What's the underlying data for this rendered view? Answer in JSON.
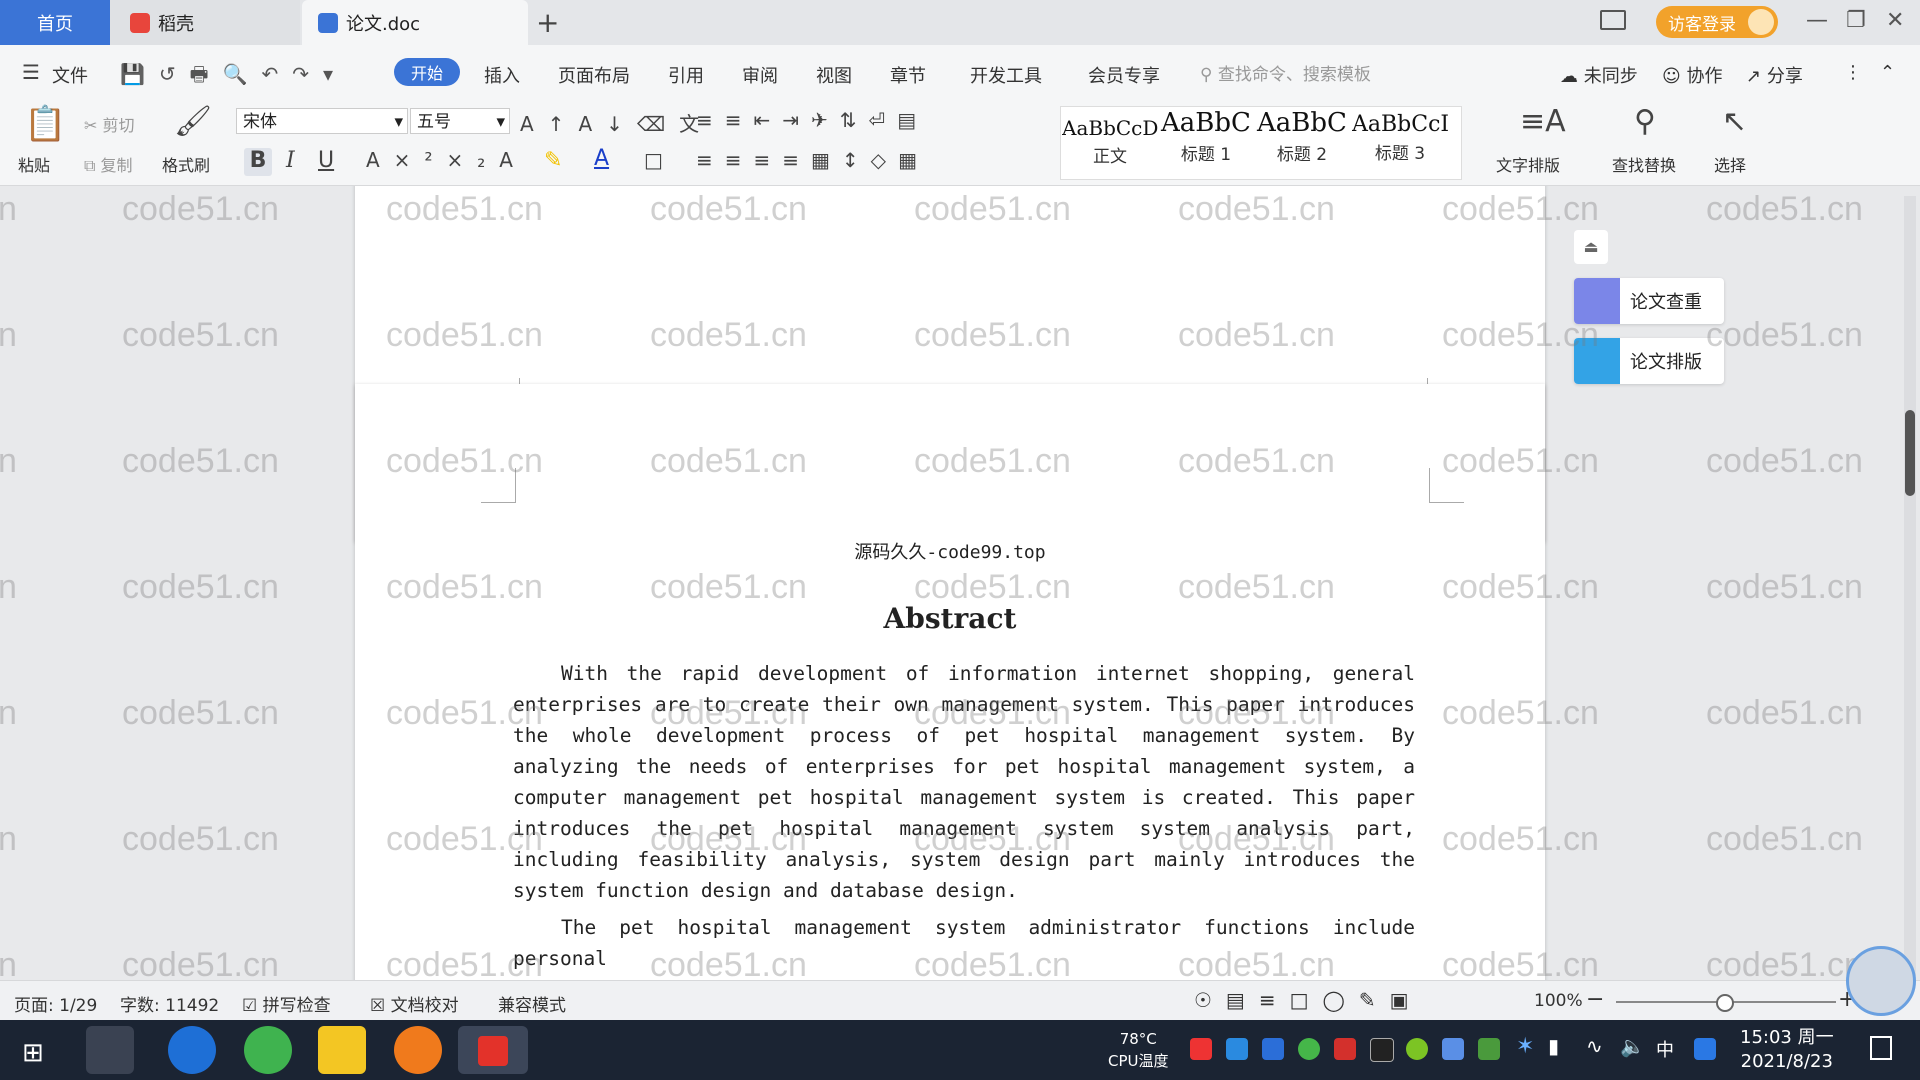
{
  "tabs": [
    {
      "label": "首页"
    },
    {
      "label": "稻壳"
    },
    {
      "label": "论文.doc"
    }
  ],
  "login_label": "访客登录",
  "menu": {
    "file": "文件",
    "items": [
      "开始",
      "插入",
      "页面布局",
      "引用",
      "审阅",
      "视图",
      "章节",
      "开发工具",
      "会员专享"
    ],
    "search_placeholder": "查找命令、搜索模板",
    "sync": "未同步",
    "collab": "协作",
    "share": "分享"
  },
  "toolbar": {
    "paste": "粘贴",
    "cut": "剪切",
    "copy": "复制",
    "format_painter": "格式刷",
    "font": "宋体",
    "size": "五号",
    "styles": [
      {
        "sample": "AaBbCcDd",
        "name": "正文"
      },
      {
        "sample": "AaBbC",
        "name": "标题 1"
      },
      {
        "sample": "AaBbC",
        "name": "标题 2"
      },
      {
        "sample": "AaBbCcI",
        "name": "标题 3"
      }
    ],
    "text_layout": "文字排版",
    "find_replace": "查找替换",
    "select": "选择"
  },
  "side_panel": {
    "check": "论文查重",
    "layout": "论文排版"
  },
  "document": {
    "header": "源码久久-code99.top",
    "title": "Abstract",
    "para1": "With the rapid development of information internet shopping, general enterprises are to create their own management system. This paper introduces the whole development process of pet hospital management system. By analyzing the needs of enterprises for pet hospital management system, a computer management pet hospital management system is created. This paper introduces the pet hospital management system system analysis part, including feasibility analysis, system design part mainly introduces the system function design and database design.",
    "para2": "The pet hospital management system administrator functions include personal"
  },
  "watermark": "code51.cn",
  "status": {
    "page": "页面: 1/29",
    "words": "字数: 11492",
    "spell": "拼写检查",
    "proof": "文档校对",
    "compat": "兼容模式",
    "zoom": "100%"
  },
  "taskbar": {
    "cpu_temp": "78°C",
    "cpu_label": "CPU温度",
    "ime": "中",
    "time": "15:03 周一",
    "date": "2021/8/23"
  }
}
